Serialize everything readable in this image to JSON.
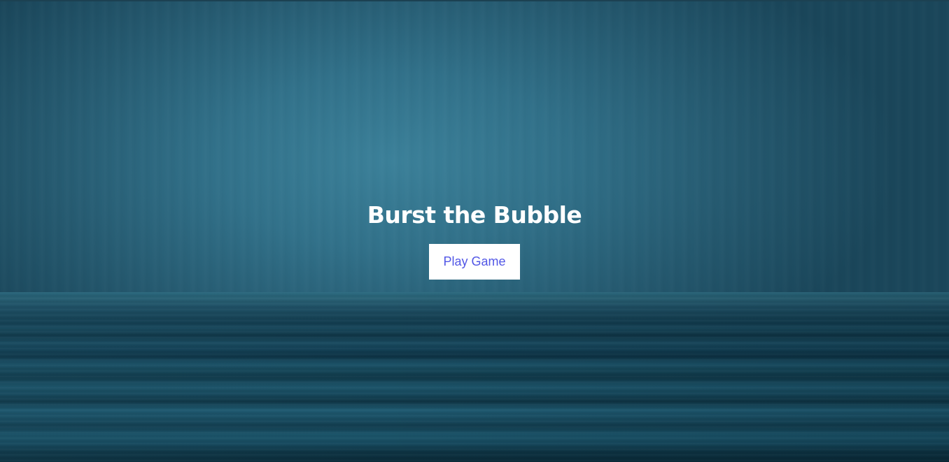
{
  "game": {
    "title": "Burst the Bubble",
    "play_button_label": "Play Game"
  },
  "colors": {
    "title_text": "#ffffff",
    "button_background": "#ffffff",
    "button_text": "#5257e6",
    "sky_tone": "#30687f",
    "sea_tone": "#123c4f"
  },
  "background": {
    "description_icon": "blurred-ocean-horizon-background"
  }
}
